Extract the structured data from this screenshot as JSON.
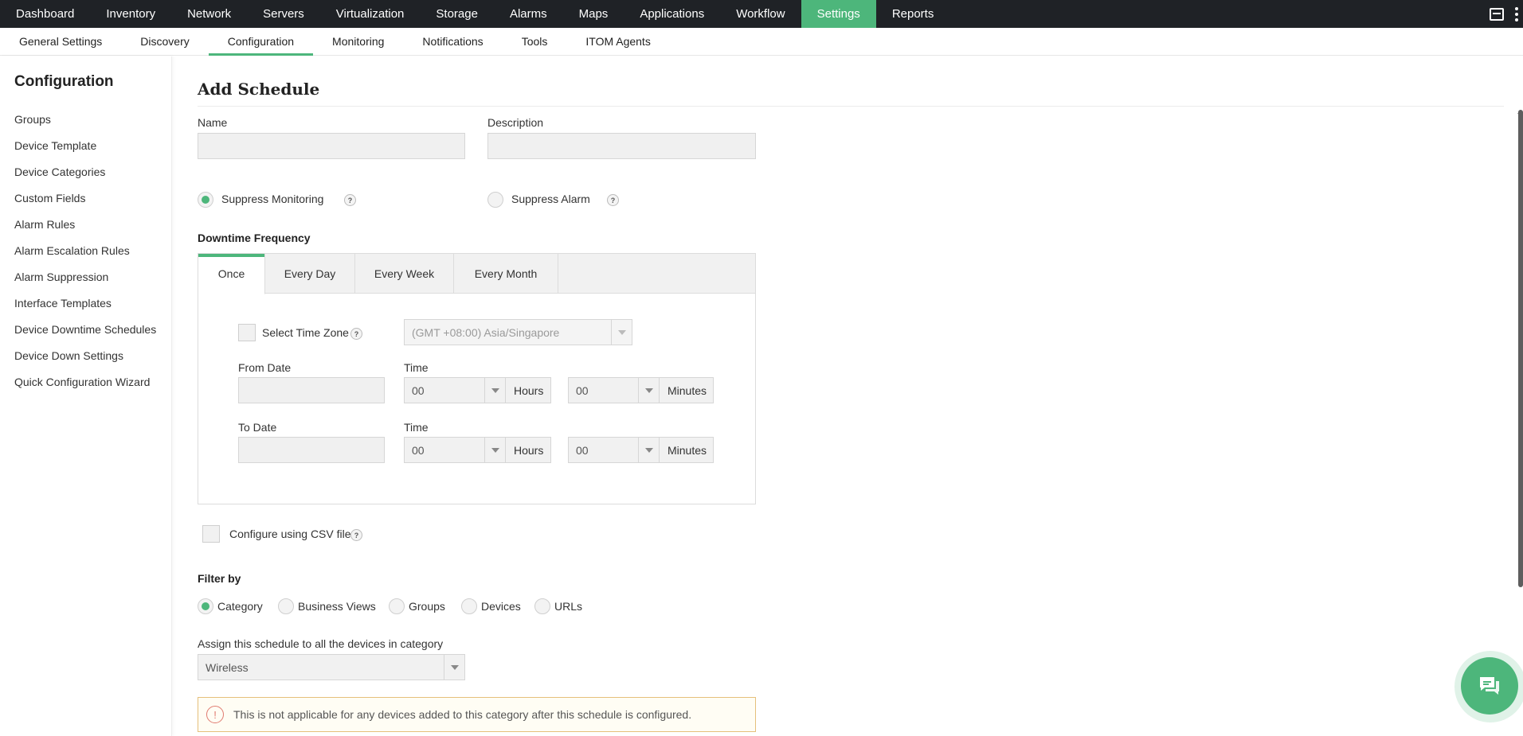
{
  "topnav": {
    "items": [
      "Dashboard",
      "Inventory",
      "Network",
      "Servers",
      "Virtualization",
      "Storage",
      "Alarms",
      "Maps",
      "Applications",
      "Workflow",
      "Settings",
      "Reports"
    ],
    "active": "Settings"
  },
  "subnav": {
    "tabs": [
      "General Settings",
      "Discovery",
      "Configuration",
      "Monitoring",
      "Notifications",
      "Tools",
      "ITOM Agents"
    ],
    "active": "Configuration"
  },
  "sidebar": {
    "title": "Configuration",
    "items": [
      "Groups",
      "Device Template",
      "Device Categories",
      "Custom Fields",
      "Alarm Rules",
      "Alarm Escalation Rules",
      "Alarm Suppression",
      "Interface Templates",
      "Device Downtime Schedules",
      "Device Down Settings",
      "Quick Configuration Wizard"
    ]
  },
  "form": {
    "title": "Add Schedule",
    "name_label": "Name",
    "name_value": "",
    "description_label": "Description",
    "description_value": "",
    "suppress_monitoring_label": "Suppress Monitoring",
    "suppress_alarm_label": "Suppress Alarm",
    "suppress_selected": "Suppress Monitoring",
    "help_glyph": "?",
    "downtime_frequency_label": "Downtime Frequency",
    "frequency_tabs": [
      "Once",
      "Every Day",
      "Every Week",
      "Every Month"
    ],
    "frequency_active": "Once",
    "select_time_zone_label": "Select Time Zone",
    "time_zone_value": "(GMT +08:00) Asia/Singapore",
    "from_date_label": "From Date",
    "from_date_value": "",
    "to_date_label": "To Date",
    "to_date_value": "",
    "time_label": "Time",
    "from_hours": "00",
    "from_minutes": "00",
    "to_hours": "00",
    "to_minutes": "00",
    "hours_label": "Hours",
    "minutes_label": "Minutes",
    "csv_label": "Configure using CSV file",
    "filter_by_label": "Filter by",
    "filter_options": [
      "Category",
      "Business Views",
      "Groups",
      "Devices",
      "URLs"
    ],
    "filter_selected": "Category",
    "assign_label": "Assign this schedule to all the devices in category",
    "category_value": "Wireless",
    "notice_text": "This is not applicable for any devices added to this category after this schedule is configured.",
    "notice_glyph": "!"
  },
  "colors": {
    "accent": "#4db67b",
    "topbar": "#1f2226",
    "notice_border": "#e5c07b",
    "warn": "#e07a6f"
  },
  "icons": [
    "screen-capture-icon",
    "kebab-menu-icon",
    "help-icon",
    "chevron-down-icon",
    "warning-icon",
    "chat-icon"
  ]
}
